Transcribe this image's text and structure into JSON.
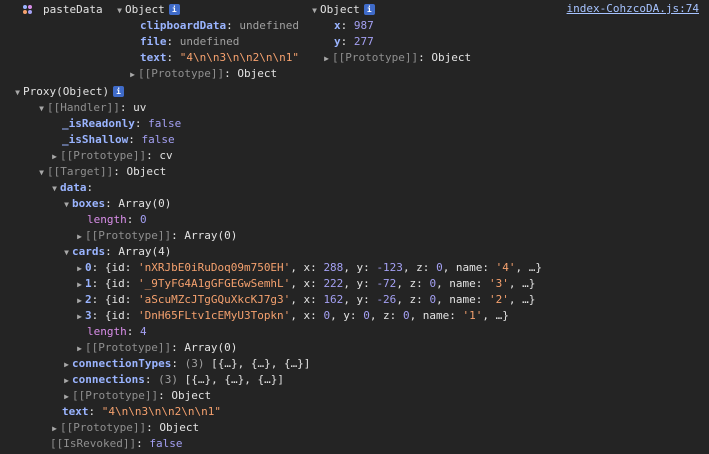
{
  "source_link": "index-CohzcoDA.js:74",
  "header": {
    "label": "pasteData",
    "obj1": {
      "title": "Object",
      "fields": [
        {
          "key": "clipboardData",
          "value": "undefined"
        },
        {
          "key": "file",
          "value": "undefined"
        },
        {
          "key": "text",
          "value": "\"4\\n\\n3\\n\\n2\\n\\n1\""
        }
      ],
      "proto": "[[Prototype]]",
      "proto_val": "Object"
    },
    "obj2": {
      "title": "Object",
      "fields": [
        {
          "key": "x",
          "value": "987"
        },
        {
          "key": "y",
          "value": "277"
        }
      ],
      "proto": "[[Prototype]]",
      "proto_val": "Object"
    }
  },
  "proxy": {
    "title": "Proxy(Object)",
    "handler": {
      "key": "[[Handler]]",
      "value": "uv"
    },
    "isReadonly": {
      "key": "_isReadonly",
      "value": "false"
    },
    "isShallow": {
      "key": "_isShallow",
      "value": "false"
    },
    "handler_proto": {
      "key": "[[Prototype]]",
      "value": "cv"
    },
    "target": {
      "key": "[[Target]]",
      "value": "Object"
    },
    "data_key": "data",
    "boxes": {
      "key": "boxes",
      "value": "Array(0)"
    },
    "boxes_length": {
      "key": "length",
      "value": "0"
    },
    "boxes_proto": {
      "key": "[[Prototype]]",
      "value": "Array(0)"
    },
    "cards": {
      "key": "cards",
      "value": "Array(4)"
    },
    "card_items": [
      {
        "idx": "0",
        "id": "'nXRJbE0iRuDoq09m750EH'",
        "x": "288",
        "y": "-123",
        "z": "0",
        "name": "'4'"
      },
      {
        "idx": "1",
        "id": "'_9TyFG4A1gGFGEGwSemhL'",
        "x": "222",
        "y": "-72",
        "z": "0",
        "name": "'3'"
      },
      {
        "idx": "2",
        "id": "'aScuMZcJTgGQuXkcKJ7g3'",
        "x": "162",
        "y": "-26",
        "z": "0",
        "name": "'2'"
      },
      {
        "idx": "3",
        "id": "'DnH65FLtv1cEMyU3Topkn'",
        "x": "0",
        "y": "0",
        "z": "0",
        "name": "'1'"
      }
    ],
    "cards_length": {
      "key": "length",
      "value": "4"
    },
    "cards_proto": {
      "key": "[[Prototype]]",
      "value": "Array(0)"
    },
    "connectionTypes": {
      "key": "connectionTypes",
      "count": "(3)",
      "value": "[{…}, {…}, {…}]"
    },
    "connections": {
      "key": "connections",
      "count": "(3)",
      "value": "[{…}, {…}, {…}]"
    },
    "data_proto": {
      "key": "[[Prototype]]",
      "value": "Object"
    },
    "text": {
      "key": "text",
      "value": "\"4\\n\\n3\\n\\n2\\n\\n1\""
    },
    "target_proto": {
      "key": "[[Prototype]]",
      "value": "Object"
    },
    "revoked": {
      "key": "[[IsRevoked]]",
      "value": "false"
    }
  },
  "icons": {
    "info": "i",
    "expanded": "▼",
    "collapsed": "▶"
  }
}
